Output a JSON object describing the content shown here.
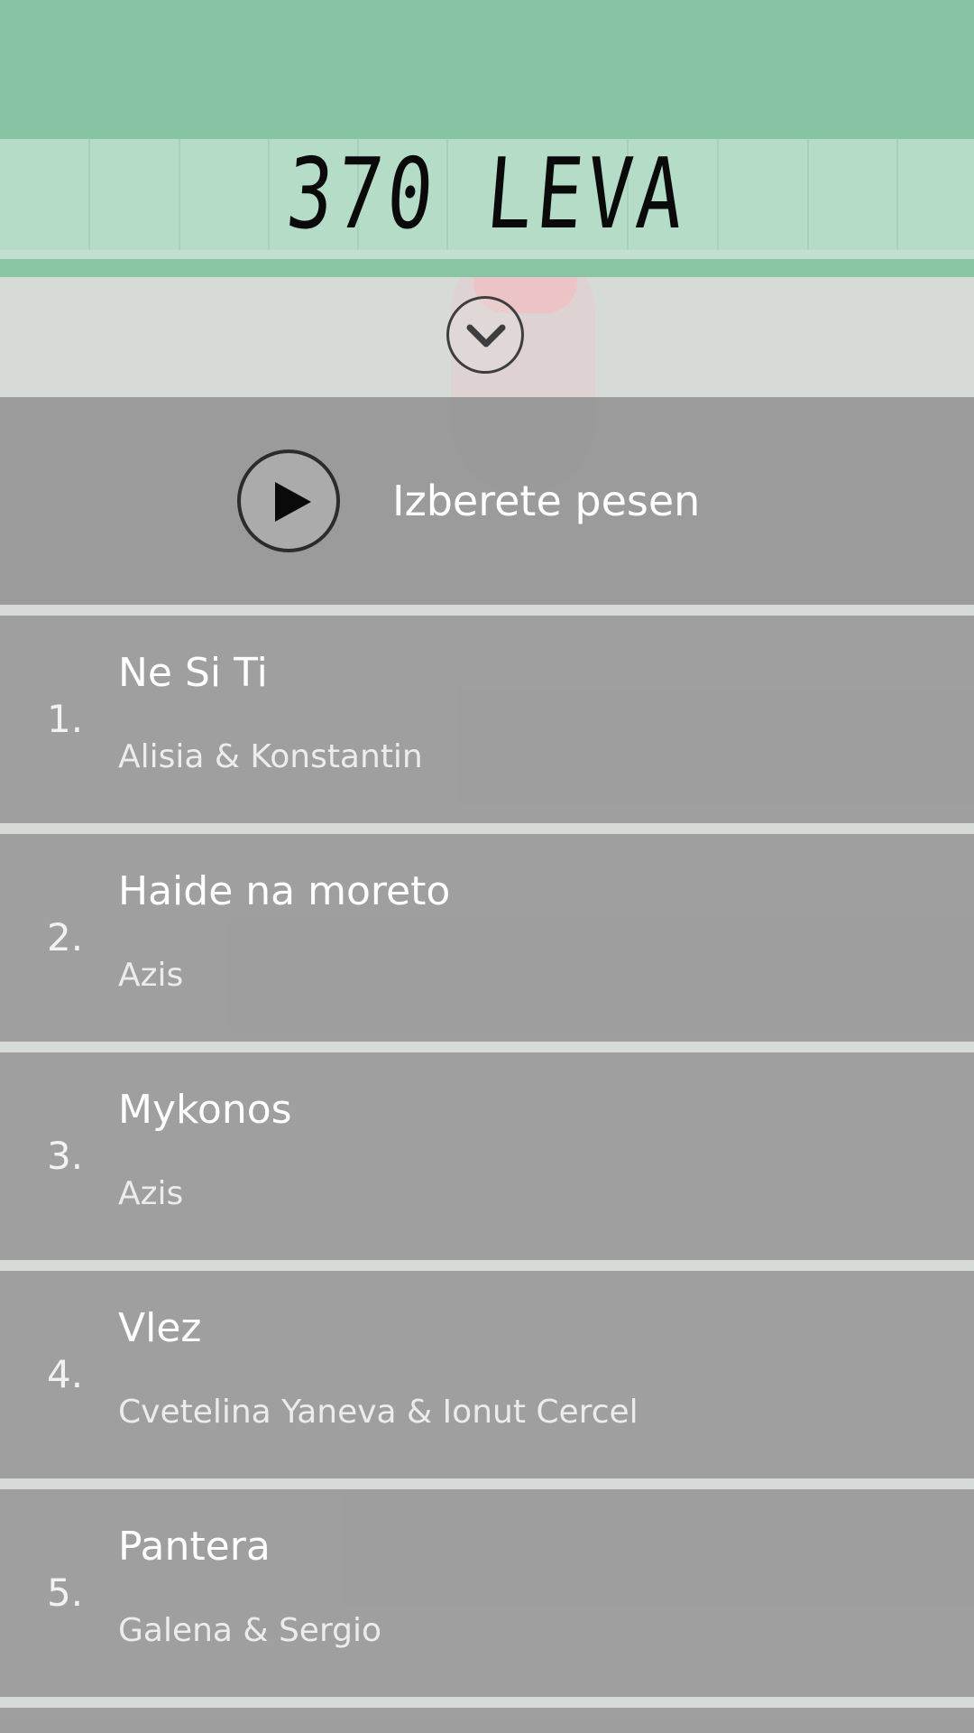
{
  "counter": {
    "value_text": "370 LEVA"
  },
  "collapse_icon": "chevron-down-icon",
  "player": {
    "play_icon": "play-icon",
    "label": "Izberete pesen"
  },
  "songs": [
    {
      "number": "1.",
      "title": "Ne Si Ti",
      "artist": "Alisia & Konstantin"
    },
    {
      "number": "2.",
      "title": "Haide na moreto",
      "artist": "Azis"
    },
    {
      "number": "3.",
      "title": "Mykonos",
      "artist": "Azis"
    },
    {
      "number": "4.",
      "title": "Vlez",
      "artist": "Cvetelina Yaneva & Ionut Cercel"
    },
    {
      "number": "5.",
      "title": "Pantera",
      "artist": "Galena & Sergio"
    }
  ],
  "colors": {
    "top_bar": "#87c4a3",
    "counter_strip": "#b4dcc7",
    "row_background": "#969696"
  }
}
